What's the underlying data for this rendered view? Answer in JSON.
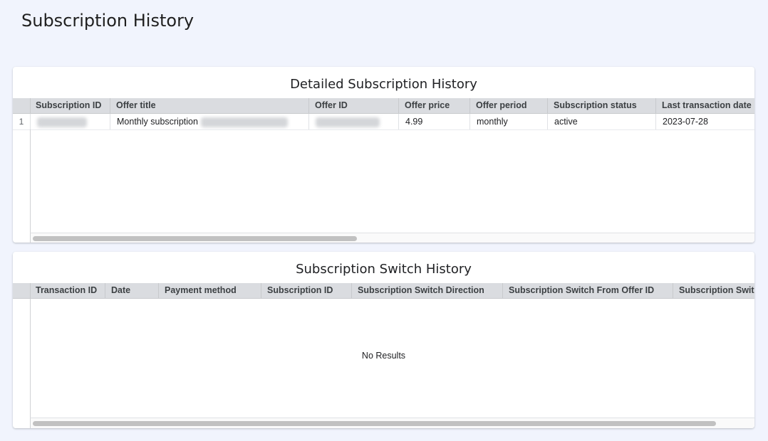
{
  "page": {
    "title": "Subscription History"
  },
  "detailed": {
    "title": "Detailed Subscription History",
    "columns": [
      "Subscription ID",
      "Offer title",
      "Offer ID",
      "Offer price",
      "Offer period",
      "Subscription status",
      "Last transaction date"
    ],
    "rows": [
      {
        "row_number": "1",
        "offer_title": "Monthly subscription",
        "offer_price": "4.99",
        "offer_period": "monthly",
        "subscription_status": "active",
        "last_transaction_date": "2023-07-28"
      }
    ]
  },
  "switch_history": {
    "title": "Subscription Switch History",
    "columns": [
      "Transaction ID",
      "Date",
      "Payment method",
      "Subscription ID",
      "Subscription Switch Direction",
      "Subscription Switch From Offer ID",
      "Subscription Switc"
    ],
    "empty_text": "No Results"
  },
  "colors": {
    "background": "#f1f4fd",
    "card": "#ffffff",
    "header": "#dadce0"
  }
}
